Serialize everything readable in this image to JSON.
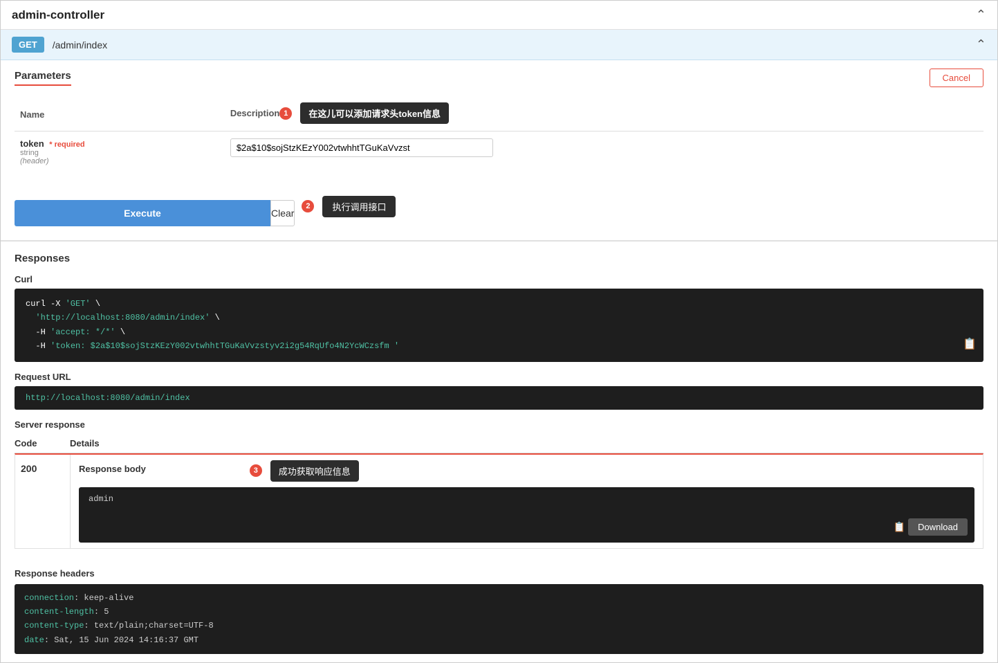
{
  "titleBar": {
    "title": "admin-controller",
    "collapseIcon": "chevron-up"
  },
  "getBar": {
    "method": "GET",
    "path": "/admin/index",
    "collapseIcon": "chevron-up"
  },
  "parameters": {
    "sectionTitle": "Parameters",
    "cancelButton": "Cancel",
    "columns": {
      "name": "Name",
      "description": "Description"
    },
    "tooltip1": {
      "badgeNum": "1",
      "text": "在这儿可以添加请求头token信息"
    },
    "fields": [
      {
        "name": "token",
        "required": "* required",
        "type": "string",
        "location": "(header)",
        "value": "$2a$10$sojStzKEzY002vtwhhtTGuKaVvzst"
      }
    ]
  },
  "buttons": {
    "execute": "Execute",
    "clear": "Clear",
    "tooltip2": {
      "badgeNum": "2",
      "text": "执行调用接口"
    }
  },
  "responses": {
    "sectionTitle": "Responses",
    "curl": {
      "label": "Curl",
      "lines": [
        "curl -X 'GET' \\",
        "  'http://localhost:8080/admin/index' \\",
        "  -H 'accept: */*' \\",
        "  -H 'token: $2a$10$sojStzKEzY002vtwhhtTGuKaVvzstyv2i2g54RqUfo4N2YcWCzsfm '"
      ]
    },
    "requestUrl": {
      "label": "Request URL",
      "url": "http://localhost:8080/admin/index"
    },
    "serverResponse": {
      "label": "Server response",
      "codeHeader": "Code",
      "detailsHeader": "Details",
      "rows": [
        {
          "code": "200",
          "bodyLabel": "Response body",
          "bodyContent": "admin",
          "tooltip3": {
            "badgeNum": "3",
            "text": "成功获取响应信息"
          }
        }
      ]
    },
    "responseHeaders": {
      "label": "Response headers",
      "lines": [
        {
          "key": "connection",
          "value": ": keep-alive"
        },
        {
          "key": "content-length",
          "value": ": 5"
        },
        {
          "key": "content-type",
          "value": ": text/plain;charset=UTF-8"
        },
        {
          "key": "date",
          "value": ": Sat, 15 Jun 2024 14:16:37 GMT"
        }
      ]
    },
    "downloadButton": "Download"
  }
}
